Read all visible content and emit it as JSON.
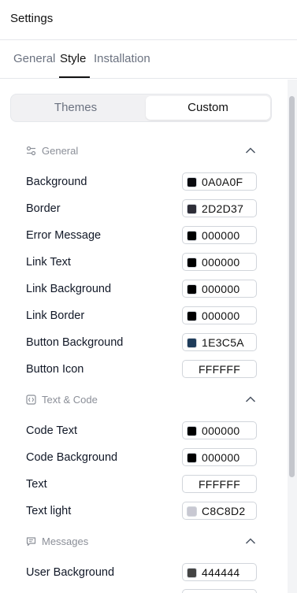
{
  "header": {
    "title": "Settings"
  },
  "tabs": [
    {
      "label": "General"
    },
    {
      "label": "Style"
    },
    {
      "label": "Installation"
    }
  ],
  "segmented": {
    "themes": "Themes",
    "custom": "Custom"
  },
  "sections": {
    "general": {
      "label": "General",
      "rows": [
        {
          "label": "Background",
          "hex": "0A0A0F",
          "swatch": "#0A0A0F"
        },
        {
          "label": "Border",
          "hex": "2D2D37",
          "swatch": "#2D2D37"
        },
        {
          "label": "Error Message",
          "hex": "000000",
          "swatch": "#000000"
        },
        {
          "label": "Link Text",
          "hex": "000000",
          "swatch": "#000000"
        },
        {
          "label": "Link Background",
          "hex": "000000",
          "swatch": "#000000"
        },
        {
          "label": "Link Border",
          "hex": "000000",
          "swatch": "#000000"
        },
        {
          "label": "Button Background",
          "hex": "1E3C5A",
          "swatch": "#1E3C5A"
        },
        {
          "label": "Button Icon",
          "hex": "FFFFFF",
          "swatch": ""
        }
      ]
    },
    "text_code": {
      "label": "Text & Code",
      "rows": [
        {
          "label": "Code Text",
          "hex": "000000",
          "swatch": "#000000"
        },
        {
          "label": "Code Background",
          "hex": "000000",
          "swatch": "#000000"
        },
        {
          "label": "Text",
          "hex": "FFFFFF",
          "swatch": ""
        },
        {
          "label": "Text light",
          "hex": "C8C8D2",
          "swatch": "#C8C8D2"
        }
      ]
    },
    "messages": {
      "label": "Messages",
      "rows": [
        {
          "label": "User Background",
          "hex": "444444",
          "swatch": "#444444"
        }
      ]
    }
  }
}
